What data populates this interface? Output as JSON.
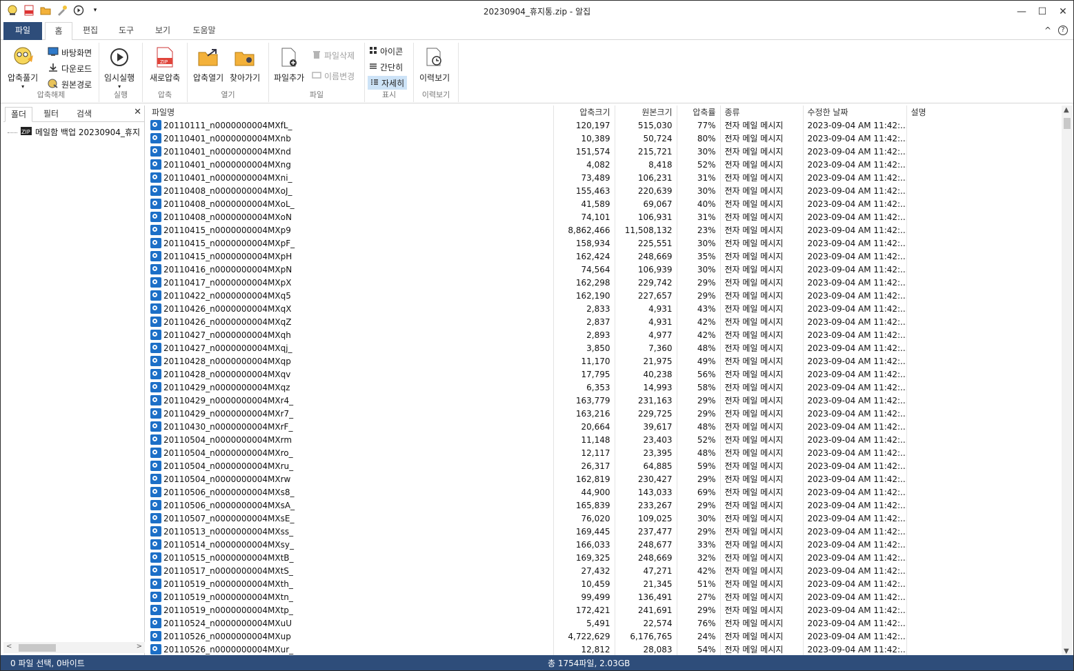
{
  "window": {
    "title": "20230904_휴지통.zip - 알집",
    "minimize": "—",
    "maximize": "☐",
    "close": "✕"
  },
  "quick_access": [
    "app-icon",
    "zip-icon",
    "folder-open-icon",
    "wizard-icon",
    "play-icon",
    "dropdown-icon"
  ],
  "ribbon_tabs": {
    "file": "파일",
    "home": "홈",
    "edit": "편집",
    "tools": "도구",
    "view": "보기",
    "help": "도움말",
    "collapse": "^",
    "help_icon": "?"
  },
  "ribbon": {
    "extract": {
      "big": "압축풀기",
      "desktop": "바탕화면",
      "download": "다운로드",
      "original": "원본경로",
      "label": "압축해제"
    },
    "run": {
      "big": "임시실행",
      "label": "실행"
    },
    "compress": {
      "big": "새로압축",
      "label": "압축"
    },
    "open": {
      "open_archive": "압축열기",
      "browse": "찾아가기",
      "label": "열기"
    },
    "file": {
      "add": "파일추가",
      "delete": "파일삭제",
      "rename": "이름변경",
      "label": "파일"
    },
    "display": {
      "icon": "아이콘",
      "simple": "간단히",
      "detail": "자세히",
      "label": "표시"
    },
    "history": {
      "big": "이력보기",
      "label": "이력보기"
    }
  },
  "left_panel": {
    "tabs": {
      "folder": "폴더",
      "filter": "필터",
      "search": "검색"
    },
    "close": "✕",
    "tree_item": "메일함 백업 20230904_휴지",
    "scroll_left": "<",
    "scroll_right": ">"
  },
  "columns": {
    "name": "파일명",
    "compressed": "압축크기",
    "original": "원본크기",
    "ratio": "압축률",
    "type": "종류",
    "modified": "수정한 날짜",
    "description": "설명"
  },
  "files": [
    {
      "name": "20110111_n0000000004MXfL_",
      "c": "120,197",
      "o": "515,030",
      "r": "77%"
    },
    {
      "name": "20110401_n0000000004MXnb",
      "c": "10,389",
      "o": "50,724",
      "r": "80%"
    },
    {
      "name": "20110401_n0000000004MXnd",
      "c": "151,574",
      "o": "215,721",
      "r": "30%"
    },
    {
      "name": "20110401_n0000000004MXng",
      "c": "4,082",
      "o": "8,418",
      "r": "52%"
    },
    {
      "name": "20110401_n0000000004MXni_",
      "c": "73,489",
      "o": "106,231",
      "r": "31%"
    },
    {
      "name": "20110408_n0000000004MXoJ_",
      "c": "155,463",
      "o": "220,639",
      "r": "30%"
    },
    {
      "name": "20110408_n0000000004MXoL_",
      "c": "41,589",
      "o": "69,067",
      "r": "40%"
    },
    {
      "name": "20110408_n0000000004MXoN",
      "c": "74,101",
      "o": "106,931",
      "r": "31%"
    },
    {
      "name": "20110415_n0000000004MXp9",
      "c": "8,862,466",
      "o": "11,508,132",
      "r": "23%"
    },
    {
      "name": "20110415_n0000000004MXpF_",
      "c": "158,934",
      "o": "225,551",
      "r": "30%"
    },
    {
      "name": "20110415_n0000000004MXpH",
      "c": "162,424",
      "o": "248,669",
      "r": "35%"
    },
    {
      "name": "20110416_n0000000004MXpN",
      "c": "74,564",
      "o": "106,939",
      "r": "30%"
    },
    {
      "name": "20110417_n0000000004MXpX",
      "c": "162,298",
      "o": "229,742",
      "r": "29%"
    },
    {
      "name": "20110422_n0000000004MXq5",
      "c": "162,190",
      "o": "227,657",
      "r": "29%"
    },
    {
      "name": "20110426_n0000000004MXqX",
      "c": "2,833",
      "o": "4,931",
      "r": "43%"
    },
    {
      "name": "20110426_n0000000004MXqZ",
      "c": "2,837",
      "o": "4,931",
      "r": "42%"
    },
    {
      "name": "20110427_n0000000004MXqh",
      "c": "2,893",
      "o": "4,977",
      "r": "42%"
    },
    {
      "name": "20110427_n0000000004MXqj_",
      "c": "3,850",
      "o": "7,360",
      "r": "48%"
    },
    {
      "name": "20110428_n0000000004MXqp",
      "c": "11,170",
      "o": "21,975",
      "r": "49%"
    },
    {
      "name": "20110428_n0000000004MXqv",
      "c": "17,795",
      "o": "40,238",
      "r": "56%"
    },
    {
      "name": "20110429_n0000000004MXqz",
      "c": "6,353",
      "o": "14,993",
      "r": "58%"
    },
    {
      "name": "20110429_n0000000004MXr4_",
      "c": "163,779",
      "o": "231,163",
      "r": "29%"
    },
    {
      "name": "20110429_n0000000004MXr7_",
      "c": "163,216",
      "o": "229,725",
      "r": "29%"
    },
    {
      "name": "20110430_n0000000004MXrF_",
      "c": "20,664",
      "o": "39,617",
      "r": "48%"
    },
    {
      "name": "20110504_n0000000004MXrm",
      "c": "11,148",
      "o": "23,403",
      "r": "52%"
    },
    {
      "name": "20110504_n0000000004MXro_",
      "c": "12,117",
      "o": "23,395",
      "r": "48%"
    },
    {
      "name": "20110504_n0000000004MXru_",
      "c": "26,317",
      "o": "64,885",
      "r": "59%"
    },
    {
      "name": "20110504_n0000000004MXrw",
      "c": "162,819",
      "o": "230,427",
      "r": "29%"
    },
    {
      "name": "20110506_n0000000004MXs8_",
      "c": "44,900",
      "o": "143,033",
      "r": "69%"
    },
    {
      "name": "20110506_n0000000004MXsA_",
      "c": "165,839",
      "o": "233,267",
      "r": "29%"
    },
    {
      "name": "20110507_n0000000004MXsE_",
      "c": "76,020",
      "o": "109,025",
      "r": "30%"
    },
    {
      "name": "20110513_n0000000004MXss_",
      "c": "169,445",
      "o": "237,477",
      "r": "29%"
    },
    {
      "name": "20110514_n0000000004MXsy_",
      "c": "166,033",
      "o": "248,677",
      "r": "33%"
    },
    {
      "name": "20110515_n0000000004MXtB_",
      "c": "169,325",
      "o": "248,669",
      "r": "32%"
    },
    {
      "name": "20110517_n0000000004MXtS_",
      "c": "27,432",
      "o": "47,271",
      "r": "42%"
    },
    {
      "name": "20110519_n0000000004MXth_",
      "c": "10,459",
      "o": "21,345",
      "r": "51%"
    },
    {
      "name": "20110519_n0000000004MXtn_",
      "c": "99,499",
      "o": "136,491",
      "r": "27%"
    },
    {
      "name": "20110519_n0000000004MXtp_",
      "c": "172,421",
      "o": "241,691",
      "r": "29%"
    },
    {
      "name": "20110524_n0000000004MXuU",
      "c": "5,491",
      "o": "22,574",
      "r": "76%"
    },
    {
      "name": "20110526_n0000000004MXup",
      "c": "4,722,629",
      "o": "6,176,765",
      "r": "24%"
    },
    {
      "name": "20110526_n0000000004MXur_",
      "c": "12,812",
      "o": "28,083",
      "r": "54%"
    }
  ],
  "file_type": "전자 메일 메시지",
  "file_modified": "2023-09-04 AM 11:42:...",
  "status": {
    "selection": "0 파일 선택,  0바이트",
    "total": "총 1754파일,  2.03GB"
  },
  "colors": {
    "accent": "#2e4d7a",
    "mail_icon": "#1c6fc7",
    "selected_view": "#cde3f7"
  }
}
